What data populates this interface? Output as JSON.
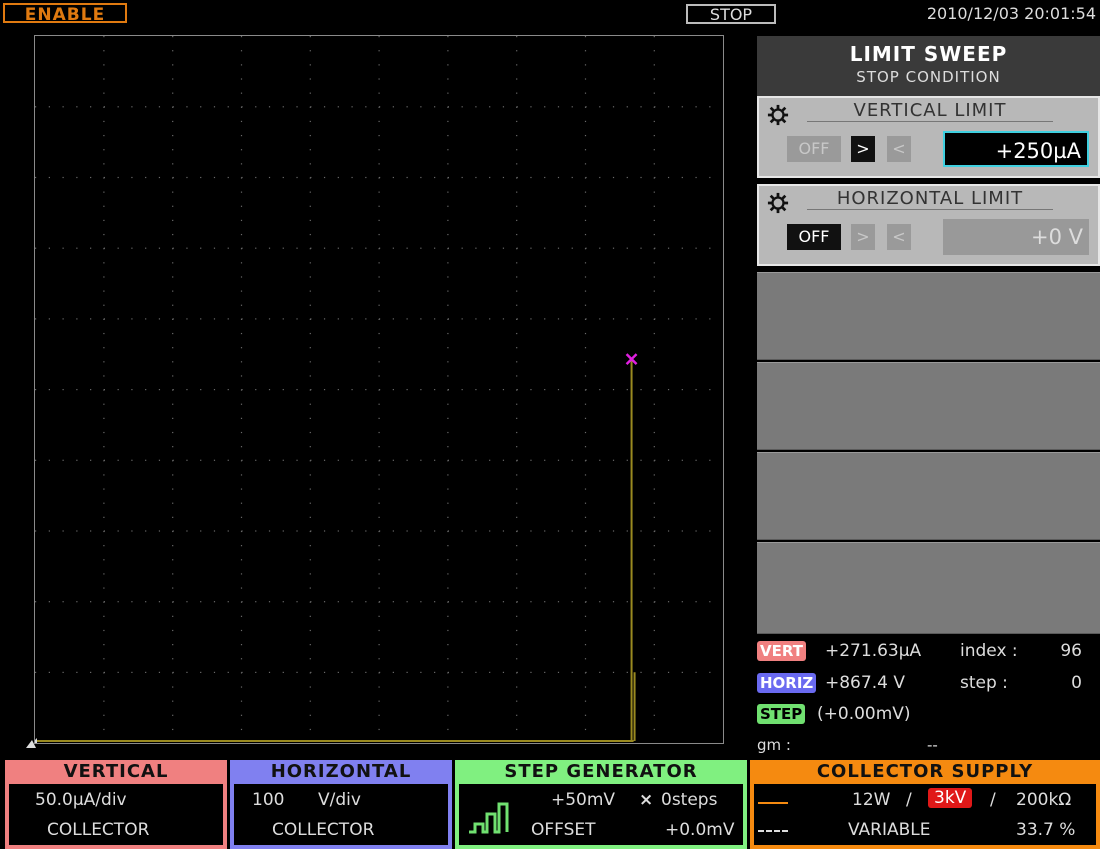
{
  "topbar": {
    "enable_label": "ENABLE",
    "stop_label": "STOP",
    "datetime": "2010/12/03 20:01:54"
  },
  "stop_condition": {
    "title": "LIMIT SWEEP",
    "subtitle": "STOP CONDITION",
    "vertical_limit": {
      "title": "VERTICAL LIMIT",
      "off_label": "OFF",
      "gt_label": ">",
      "lt_label": "<",
      "selected": ">",
      "value": "+250µA"
    },
    "horizontal_limit": {
      "title": "HORIZONTAL LIMIT",
      "off_label": "OFF",
      "gt_label": ">",
      "lt_label": "<",
      "selected": "OFF",
      "value": "+0 V"
    }
  },
  "readout": {
    "vert_tag": "VERT",
    "vert_value": "+271.63µA",
    "index_label": "index :",
    "index_value": "96",
    "horiz_tag": "HORIZ",
    "horiz_value": "+867.4 V",
    "step_label": "step :",
    "step_value": "0",
    "step_tag": "STEP",
    "step_offset": "(+0.00mV)",
    "gm_label": "gm :",
    "gm_value": "--"
  },
  "bottom": {
    "vertical": {
      "title": "VERTICAL",
      "scale": "50.0µA/div",
      "source": "COLLECTOR",
      "color": "#f08080"
    },
    "horizontal": {
      "title": "HORIZONTAL",
      "scale_num": "100",
      "scale_unit": "V/div",
      "source": "COLLECTOR",
      "color": "#8080f0"
    },
    "step_generator": {
      "title": "STEP GENERATOR",
      "step_value": "+50mV",
      "times": "×",
      "steps": "0steps",
      "offset_label": "OFFSET",
      "offset_value": "+0.0mV",
      "color": "#80f080"
    },
    "collector_supply": {
      "title": "COLLECTOR SUPPLY",
      "power": "12W",
      "sep1": "/",
      "voltage": "3kV",
      "sep2": "/",
      "resistance": "200kΩ",
      "mode": "VARIABLE",
      "percent": "33.7 %",
      "color": "#f58a10"
    }
  },
  "colors": {
    "trace": "#9a8a20",
    "cursor": "#e020e0",
    "grid_dot": "#6a6a6a"
  },
  "trace": {
    "cursor_x_div": 8.7,
    "cursor_y_div": 5.43,
    "end_y_div": 1.0
  }
}
